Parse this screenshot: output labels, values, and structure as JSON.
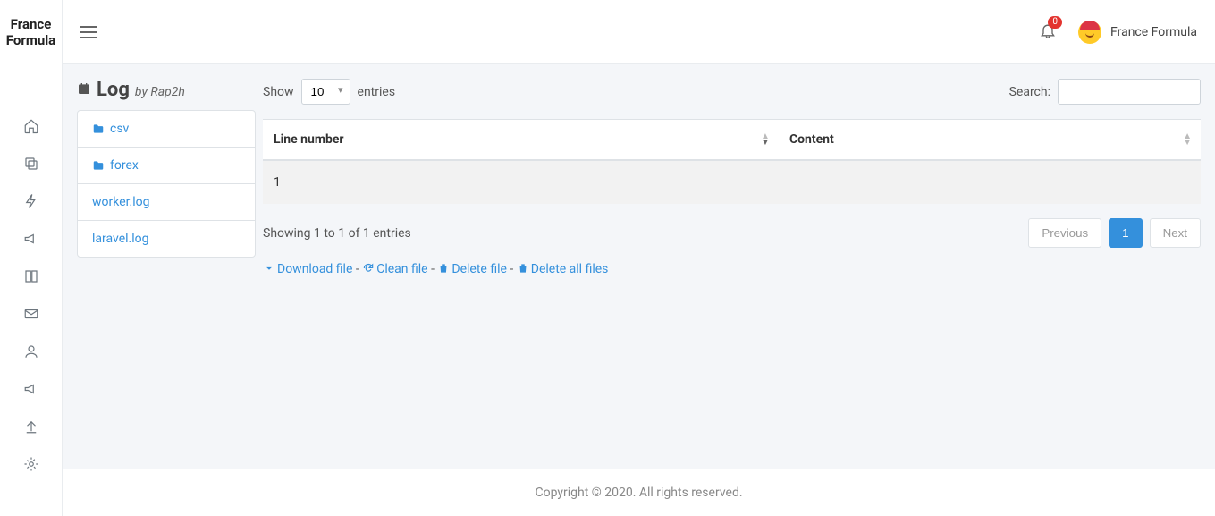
{
  "brand": "France Formula",
  "topbar": {
    "notification_count": "0",
    "username": "France Formula"
  },
  "log_panel": {
    "title": "Log",
    "by_prefix": "by",
    "by_author": "Rap2h",
    "items": [
      {
        "label": "csv",
        "type": "folder"
      },
      {
        "label": "forex",
        "type": "folder"
      },
      {
        "label": "worker.log",
        "type": "file"
      },
      {
        "label": "laravel.log",
        "type": "file"
      }
    ]
  },
  "table": {
    "show_label": "Show",
    "show_value": "10",
    "entries_label": "entries",
    "search_label": "Search:",
    "columns": [
      "Line number",
      "Content"
    ],
    "rows": [
      {
        "line": "1",
        "content": ""
      }
    ],
    "info": "Showing 1 to 1 of 1 entries",
    "prev_label": "Previous",
    "next_label": "Next",
    "page": "1"
  },
  "actions": {
    "download": "Download file",
    "clean": "Clean file",
    "delete": "Delete file",
    "delete_all": "Delete all files"
  },
  "footer": "Copyright © 2020. All rights reserved."
}
